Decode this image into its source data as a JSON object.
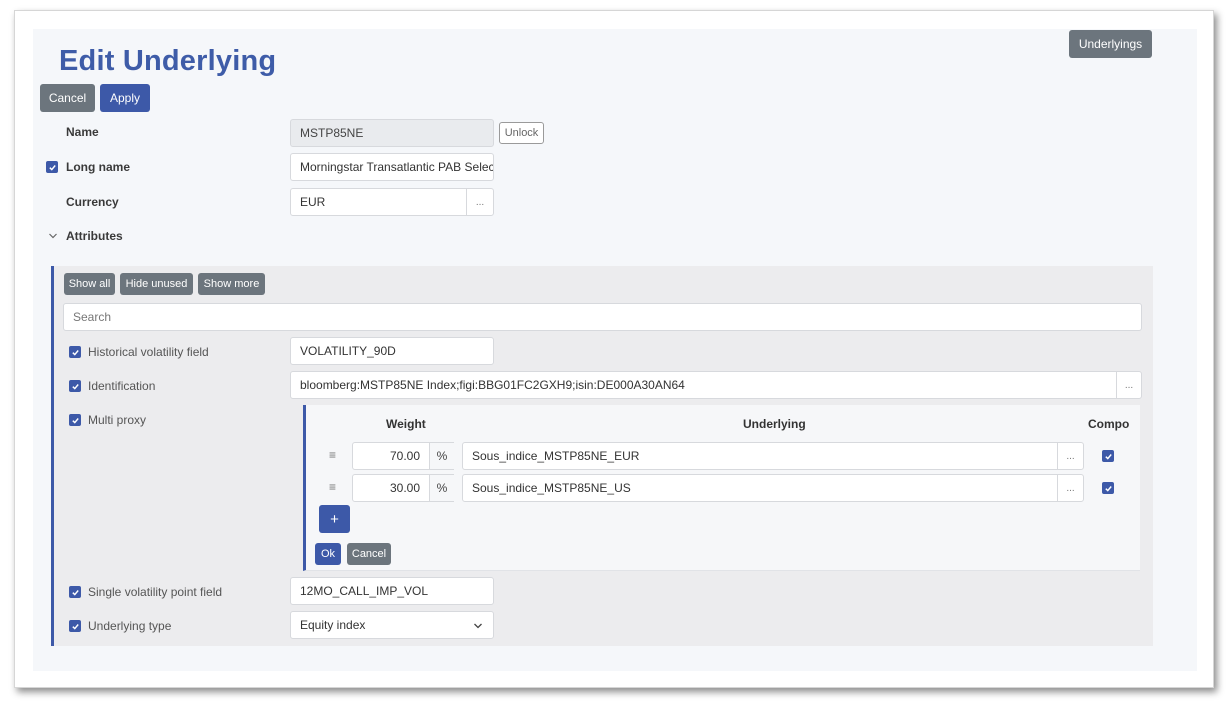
{
  "header": {
    "title": "Edit Underlying",
    "underlyings_button": "Underlyings"
  },
  "actions": {
    "cancel": "Cancel",
    "apply": "Apply"
  },
  "form": {
    "name": {
      "label": "Name",
      "value": "MSTP85NE",
      "unlock": "Unlock"
    },
    "long_name": {
      "label": "Long name",
      "value": "Morningstar Transatlantic PAB Selec",
      "checked": true
    },
    "currency": {
      "label": "Currency",
      "value": "EUR",
      "picker": "..."
    }
  },
  "attributes": {
    "label": "Attributes",
    "buttons": {
      "show_all": "Show all",
      "hide_unused": "Hide unused",
      "show_more": "Show more"
    },
    "search_placeholder": "Search",
    "historical_volatility": {
      "label": "Historical volatility field",
      "value": "VOLATILITY_90D",
      "checked": true
    },
    "identification": {
      "label": "Identification",
      "value": "bloomberg:MSTP85NE Index;figi:BBG01FC2GXH9;isin:DE000A30AN64",
      "picker": "...",
      "checked": true
    },
    "multi_proxy": {
      "label": "Multi proxy",
      "checked": true,
      "columns": {
        "weight": "Weight",
        "underlying": "Underlying",
        "compo": "Compo"
      },
      "rows": [
        {
          "weight": "70.00",
          "unit": "%",
          "underlying": "Sous_indice_MSTP85NE_EUR",
          "picker": "...",
          "compo": true
        },
        {
          "weight": "30.00",
          "unit": "%",
          "underlying": "Sous_indice_MSTP85NE_US",
          "picker": "...",
          "compo": true
        }
      ],
      "add": "+",
      "ok": "Ok",
      "cancel": "Cancel"
    },
    "single_volatility": {
      "label": "Single volatility point field",
      "value": "12MO_CALL_IMP_VOL",
      "checked": true
    },
    "underlying_type": {
      "label": "Underlying type",
      "value": "Equity index",
      "checked": true
    }
  },
  "colors": {
    "accent": "#3d59a8",
    "title": "#3e5ca8",
    "secondary": "#6c757d"
  }
}
